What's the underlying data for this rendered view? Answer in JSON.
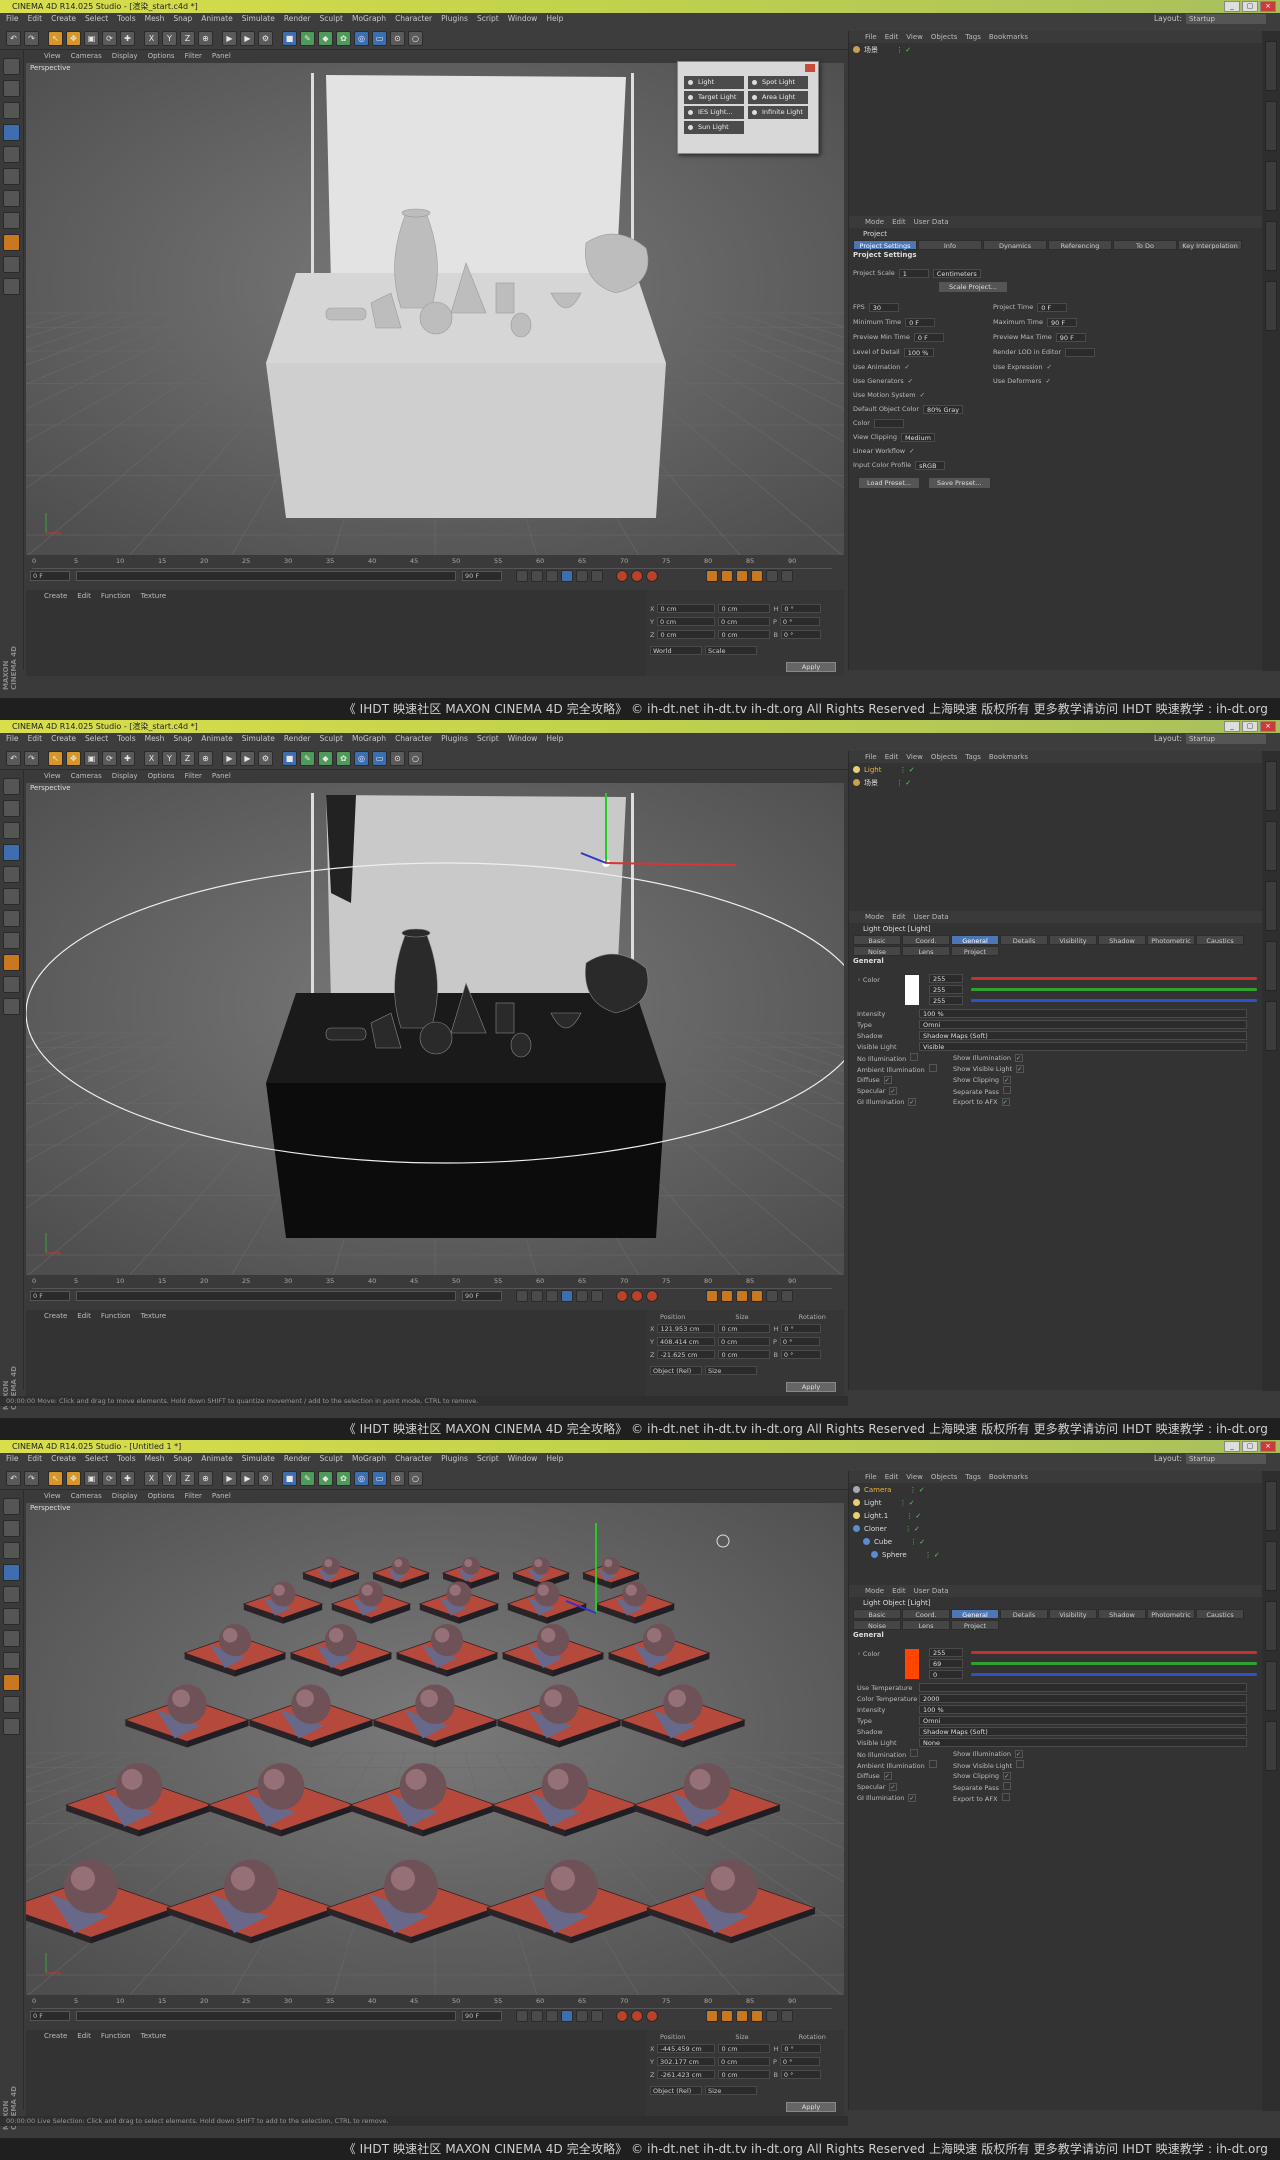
{
  "app": {
    "menu": [
      "File",
      "Edit",
      "Create",
      "Select",
      "Tools",
      "Mesh",
      "Snap",
      "Animate",
      "Simulate",
      "Render",
      "Sculpt",
      "MoGraph",
      "Character",
      "Plugins",
      "Script",
      "Window",
      "Help"
    ],
    "layout_label": "Layout:",
    "layout_value": "Startup",
    "viewport_menu": [
      "View",
      "Cameras",
      "Display",
      "Options",
      "Filter",
      "Panel"
    ],
    "viewport_label": "Perspective",
    "timeline_ticks": [
      "0",
      "5",
      "10",
      "15",
      "20",
      "25",
      "30",
      "35",
      "40",
      "45",
      "50",
      "55",
      "60",
      "65",
      "70",
      "75",
      "80",
      "85",
      "90"
    ],
    "frame_start": "0 F",
    "frame_end": "90 F",
    "frame_cur": "0 F",
    "material_menu": [
      "Create",
      "Edit",
      "Function",
      "Texture"
    ],
    "object_menu": [
      "File",
      "Edit",
      "View",
      "Objects",
      "Tags",
      "Bookmarks"
    ],
    "attr_menu": [
      "Mode",
      "Edit",
      "User Data"
    ],
    "coord_headers": [
      "Position",
      "Size",
      "Rotation"
    ],
    "apply_label": "Apply",
    "logo_top": "MAXON",
    "logo_bottom": "CINEMA 4D",
    "watermark": "《 IHDT 映速社区 MAXON CINEMA 4D 完全攻略》 © ih-dt.net ih-dt.tv  ih-dt.org  All Rights Reserved 上海映速 版权所有    更多教学请访问 IHDT 映速教学 : ih-dt.org"
  },
  "shot1": {
    "title": "CINEMA 4D R14.025 Studio - [渲染_start.c4d *]",
    "objects": [
      {
        "name": "场景"
      }
    ],
    "light_popup": [
      "Light",
      "Spot Light",
      "Target Light",
      "Area Light",
      "IES Light...",
      "Infinite Light",
      "Sun Light"
    ],
    "attr_title": "Project",
    "tabs": [
      "Project Settings",
      "Info",
      "Dynamics",
      "Referencing",
      "To Do",
      "Key Interpolation"
    ],
    "section": "Project Settings",
    "props": [
      {
        "label": "Project Scale",
        "value": "1",
        "extra": "Centimeters"
      },
      {
        "label": "FPS",
        "value": "30"
      },
      {
        "label": "Project Time",
        "value": "0 F"
      },
      {
        "label": "Minimum Time",
        "value": "0 F"
      },
      {
        "label": "Maximum Time",
        "value": "90 F"
      },
      {
        "label": "Preview Min Time",
        "value": "0 F"
      },
      {
        "label": "Preview Max Time",
        "value": "90 F"
      },
      {
        "label": "Level of Detail",
        "value": "100 %"
      },
      {
        "label": "Render LOD in Editor",
        "value": ""
      },
      {
        "label": "Use Animation",
        "value": "✓"
      },
      {
        "label": "Use Expression",
        "value": "✓"
      },
      {
        "label": "Use Generators",
        "value": "✓"
      },
      {
        "label": "Use Deformers",
        "value": "✓"
      },
      {
        "label": "Use Motion System",
        "value": "✓"
      },
      {
        "label": "Default Object Color",
        "value": "80% Gray"
      },
      {
        "label": "Color",
        "value": ""
      },
      {
        "label": "View Clipping",
        "value": "Medium"
      },
      {
        "label": "Linear Workflow",
        "value": "✓"
      },
      {
        "label": "Input Color Profile",
        "value": "sRGB"
      }
    ],
    "scale_btn": "Scale Project...",
    "load_btn": "Load Preset...",
    "save_btn": "Save Preset...",
    "coords": [
      {
        "axis": "X",
        "pos": "0 cm",
        "size": "0 cm",
        "rot": "H",
        "rv": "0 °"
      },
      {
        "axis": "Y",
        "pos": "0 cm",
        "size": "0 cm",
        "rot": "P",
        "rv": "0 °"
      },
      {
        "axis": "Z",
        "pos": "0 cm",
        "size": "0 cm",
        "rot": "B",
        "rv": "0 °"
      }
    ],
    "coord_mode": [
      "World",
      "Scale"
    ]
  },
  "shot2": {
    "title": "CINEMA 4D R14.025 Studio - [渲染_start.c4d *]",
    "objects": [
      {
        "name": "Light"
      },
      {
        "name": "场景"
      }
    ],
    "attr_title": "Light Object [Light]",
    "tabs": [
      "Basic",
      "Coord.",
      "General",
      "Details",
      "Visibility",
      "Shadow",
      "Photometric",
      "Caustics",
      "Noise",
      "Lens",
      "Project"
    ],
    "section": "General",
    "color_rgb": [
      "255",
      "255",
      "255"
    ],
    "props": [
      {
        "label": "Intensity",
        "value": "100 %"
      },
      {
        "label": "Type",
        "value": "Omni"
      },
      {
        "label": "Shadow",
        "value": "Shadow Maps (Soft)"
      },
      {
        "label": "Visible Light",
        "value": "Visible"
      },
      {
        "label": "No Illumination",
        "value": ""
      },
      {
        "label": "Show Illumination",
        "value": "✓"
      },
      {
        "label": "Ambient Illumination",
        "value": ""
      },
      {
        "label": "Show Visible Light",
        "value": "✓"
      },
      {
        "label": "Diffuse",
        "value": "✓"
      },
      {
        "label": "Show Clipping",
        "value": "✓"
      },
      {
        "label": "Specular",
        "value": "✓"
      },
      {
        "label": "Separate Pass",
        "value": ""
      },
      {
        "label": "GI Illumination",
        "value": "✓"
      },
      {
        "label": "Export to AFX",
        "value": "✓"
      }
    ],
    "coords": [
      {
        "axis": "X",
        "pos": "121.953 cm",
        "size": "0 cm",
        "rot": "H",
        "rv": "0 °"
      },
      {
        "axis": "Y",
        "pos": "408.414 cm",
        "size": "0 cm",
        "rot": "P",
        "rv": "0 °"
      },
      {
        "axis": "Z",
        "pos": "-21.625 cm",
        "size": "0 cm",
        "rot": "B",
        "rv": "0 °"
      }
    ],
    "coord_mode": [
      "Object (Rel)",
      "Size"
    ],
    "status": "00:00:00   Move: Click and drag to move elements. Hold down SHIFT to quantize movement / add to the selection in point mode, CTRL to remove."
  },
  "shot3": {
    "title": "CINEMA 4D R14.025 Studio - [Untitled 1 *]",
    "objects": [
      {
        "name": "Camera"
      },
      {
        "name": "Light"
      },
      {
        "name": "Light.1"
      },
      {
        "name": "Cloner"
      },
      {
        "name": "Cube"
      },
      {
        "name": "Sphere"
      }
    ],
    "attr_title": "Light Object [Light]",
    "tabs": [
      "Basic",
      "Coord.",
      "General",
      "Details",
      "Visibility",
      "Shadow",
      "Photometric",
      "Caustics",
      "Noise",
      "Lens",
      "Project"
    ],
    "section": "General",
    "color_rgb": [
      "255",
      "69",
      "0"
    ],
    "props": [
      {
        "label": "Use Temperature",
        "value": ""
      },
      {
        "label": "Color Temperature",
        "value": "2000"
      },
      {
        "label": "Intensity",
        "value": "100 %"
      },
      {
        "label": "Type",
        "value": "Omni"
      },
      {
        "label": "Shadow",
        "value": "Shadow Maps (Soft)"
      },
      {
        "label": "Visible Light",
        "value": "None"
      },
      {
        "label": "No Illumination",
        "value": ""
      },
      {
        "label": "Show Illumination",
        "value": "✓"
      },
      {
        "label": "Ambient Illumination",
        "value": ""
      },
      {
        "label": "Show Visible Light",
        "value": ""
      },
      {
        "label": "Diffuse",
        "value": "✓"
      },
      {
        "label": "Show Clipping",
        "value": "✓"
      },
      {
        "label": "Specular",
        "value": "✓"
      },
      {
        "label": "Separate Pass",
        "value": ""
      },
      {
        "label": "GI Illumination",
        "value": "✓"
      },
      {
        "label": "Export to AFX",
        "value": ""
      }
    ],
    "coords": [
      {
        "axis": "X",
        "pos": "-445.459 cm",
        "size": "0 cm",
        "rot": "H",
        "rv": "0 °"
      },
      {
        "axis": "Y",
        "pos": "302.177 cm",
        "size": "0 cm",
        "rot": "P",
        "rv": "0 °"
      },
      {
        "axis": "Z",
        "pos": "-261.423 cm",
        "size": "0 cm",
        "rot": "B",
        "rv": "0 °"
      }
    ],
    "coord_mode": [
      "Object (Rel)",
      "Size"
    ],
    "status": "00:00:00   Live Selection: Click and drag to select elements. Hold down SHIFT to add to the selection, CTRL to remove."
  },
  "colors": {
    "accent": "#4d76b4",
    "title_bar": "#d9de4c",
    "orange": "#ff4500"
  }
}
